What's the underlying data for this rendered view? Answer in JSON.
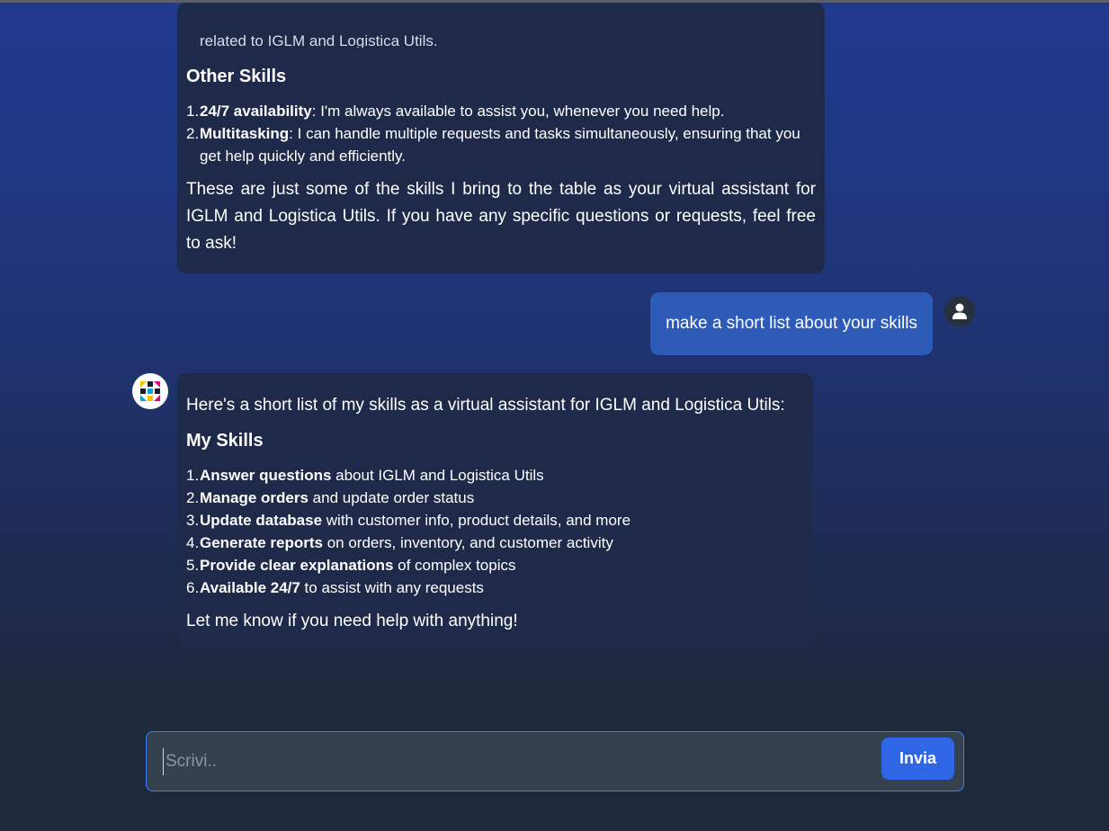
{
  "messages": {
    "bot_1": {
      "cutoff_text": "related to IGLM and Logistica Utils.",
      "heading": "Other Skills",
      "items": [
        {
          "num": "1.",
          "bold": "24/7 availability",
          "rest": ": I'm always available to assist you, whenever you need help."
        },
        {
          "num": "2.",
          "bold": "Multitasking",
          "rest": ": I can handle multiple requests and tasks simultaneously, ensuring that you get help quickly and efficiently."
        }
      ],
      "closing": "These are just some of the skills I bring to the table as your virtual assistant for IGLM and Logistica Utils. If you have any specific questions or requests, feel free to ask!"
    },
    "user_1": {
      "text": "make a short list about your skills"
    },
    "bot_2": {
      "intro": "Here's a short list of my skills as a virtual assistant for IGLM and Logistica Utils:",
      "heading": "My Skills",
      "items": [
        {
          "num": "1.",
          "bold": "Answer questions",
          "rest": " about IGLM and Logistica Utils"
        },
        {
          "num": "2.",
          "bold": "Manage orders",
          "rest": " and update order status"
        },
        {
          "num": "3.",
          "bold": "Update database",
          "rest": " with customer info, product details, and more"
        },
        {
          "num": "4.",
          "bold": "Generate reports",
          "rest": " on orders, inventory, and customer activity"
        },
        {
          "num": "5.",
          "bold": "Provide clear explanations",
          "rest": " of complex topics"
        },
        {
          "num": "6.",
          "bold": "Available 24/7",
          "rest": " to assist with any requests"
        }
      ],
      "closing": "Let me know if you need help with anything!"
    }
  },
  "composer": {
    "placeholder": "Scrivi..",
    "value": "",
    "send_label": "Invia"
  },
  "icons": {
    "user_avatar": "user-icon",
    "bot_avatar": "assistant-logo-icon"
  },
  "colors": {
    "accent": "#2f66e6",
    "user_bubble": "#2f5bb8",
    "bot_bubble": "#1f2a4a",
    "input_border": "#3b82f6"
  }
}
